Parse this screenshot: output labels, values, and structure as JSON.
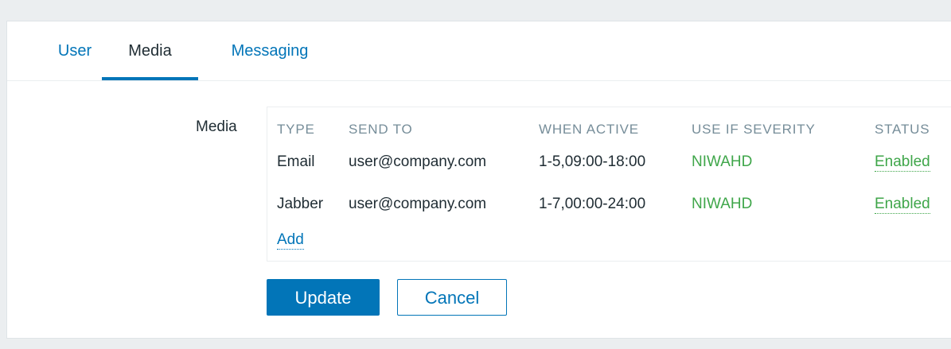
{
  "tabs": [
    {
      "label": "User",
      "active": false
    },
    {
      "label": "Media",
      "active": true
    },
    {
      "label": "Messaging",
      "active": false
    }
  ],
  "form": {
    "media_label": "Media"
  },
  "media_table": {
    "headers": [
      "TYPE",
      "SEND TO",
      "WHEN ACTIVE",
      "USE IF SEVERITY",
      "STATUS"
    ],
    "rows": [
      {
        "type": "Email",
        "send_to": "user@company.com",
        "when_active": "1-5,09:00-18:00",
        "severity": "NIWAHD",
        "status": "Enabled"
      },
      {
        "type": "Jabber",
        "send_to": "user@company.com",
        "when_active": "1-7,00:00-24:00",
        "severity": "NIWAHD",
        "status": "Enabled"
      }
    ],
    "add_label": "Add"
  },
  "buttons": {
    "update": "Update",
    "cancel": "Cancel"
  },
  "colors": {
    "accent": "#0275b8",
    "enabled": "#3fa64a",
    "severity": "#3fa64a",
    "text": "#1f2c33",
    "header_text": "#768d99"
  }
}
